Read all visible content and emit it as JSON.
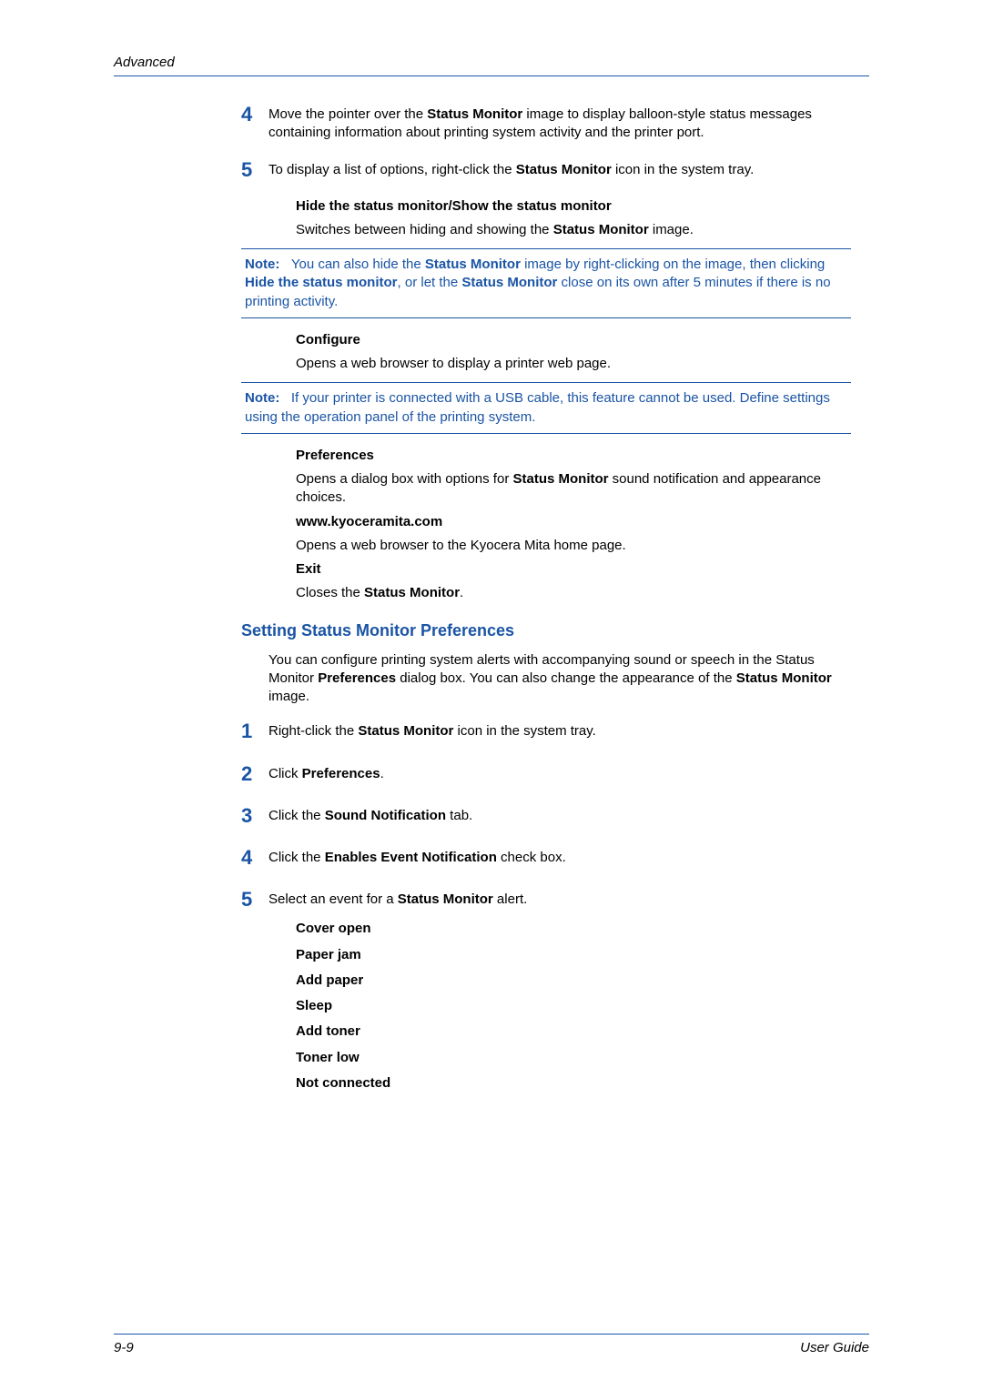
{
  "header": {
    "section": "Advanced"
  },
  "steps_a": {
    "s4": {
      "num": "4",
      "text_parts": [
        "Move the pointer over the ",
        "Status Monitor",
        " image to display balloon-style status messages containing information about printing system activity and the printer port."
      ]
    },
    "s5": {
      "num": "5",
      "text_parts": [
        "To display a list of options, right-click the ",
        "Status Monitor",
        " icon in the system tray."
      ]
    }
  },
  "sub_hide": {
    "title": "Hide the status monitor/Show the status monitor",
    "text_parts": [
      "Switches between hiding and showing the ",
      "Status Monitor",
      " image."
    ]
  },
  "note1": {
    "label": "Note:",
    "parts": [
      "You can also hide the ",
      "Status Monitor",
      " image by right-clicking on the image, then clicking ",
      "Hide the status monitor",
      ", or let the ",
      "Status Monitor",
      " close on its own after 5 minutes if there is no printing activity."
    ]
  },
  "sub_configure": {
    "title": "Configure",
    "text": "Opens a web browser to display a printer web page."
  },
  "note2": {
    "label": "Note:",
    "text": "If your printer is connected with a USB cable, this feature cannot be used. Define settings using the operation panel of the printing system."
  },
  "sub_prefs": {
    "title": "Preferences",
    "text_parts": [
      "Opens a dialog box with options for ",
      "Status Monitor",
      " sound notification and appearance choices."
    ]
  },
  "sub_www": {
    "title": "www.kyoceramita.com",
    "text": "Opens a web browser to the Kyocera Mita home page."
  },
  "sub_exit": {
    "title": "Exit",
    "text_parts": [
      "Closes the ",
      "Status Monitor",
      "."
    ]
  },
  "h2": "Setting Status Monitor Preferences",
  "intro_parts": [
    "You can configure printing system alerts with accompanying sound or speech in the Status Monitor ",
    "Preferences",
    " dialog box. You can also change the appearance of the ",
    "Status Monitor",
    " image."
  ],
  "steps_b": {
    "s1": {
      "num": "1",
      "parts": [
        "Right-click the ",
        "Status Monitor",
        " icon in the system tray."
      ]
    },
    "s2": {
      "num": "2",
      "parts": [
        "Click ",
        "Preferences",
        "."
      ]
    },
    "s3": {
      "num": "3",
      "parts": [
        "Click the ",
        "Sound Notification",
        " tab."
      ]
    },
    "s4": {
      "num": "4",
      "parts": [
        "Click the ",
        "Enables Event Notification",
        " check box."
      ]
    },
    "s5": {
      "num": "5",
      "parts": [
        "Select an event for a ",
        "Status Monitor",
        " alert."
      ]
    }
  },
  "events": [
    "Cover open",
    "Paper jam",
    "Add paper",
    "Sleep",
    "Add toner",
    "Toner low",
    "Not connected"
  ],
  "footer": {
    "page": "9-9",
    "doc": "User Guide"
  }
}
